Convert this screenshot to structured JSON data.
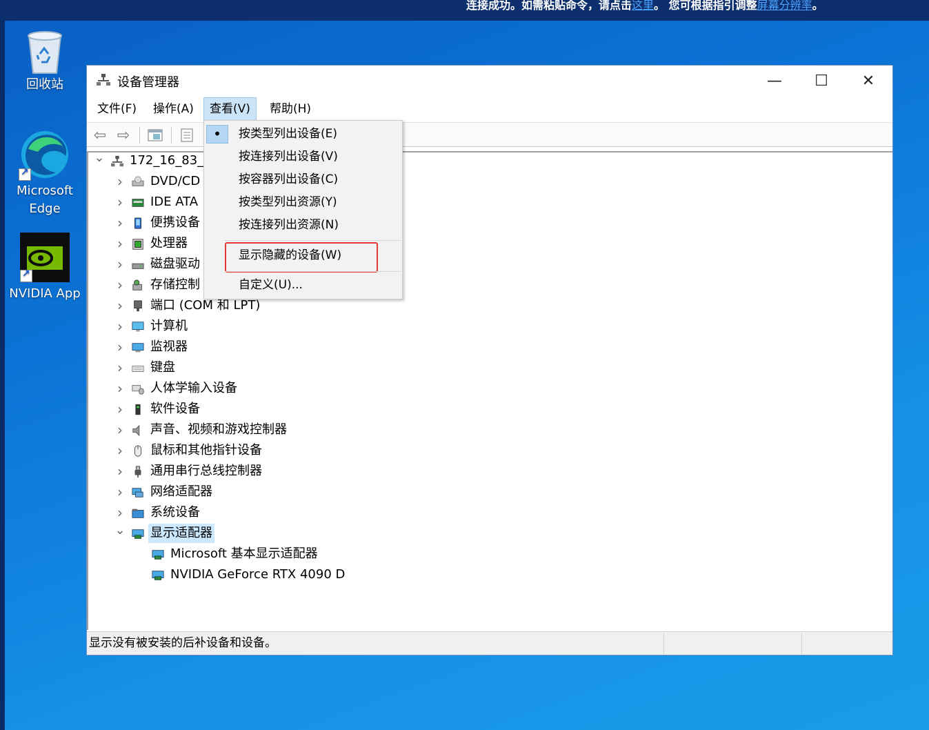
{
  "banner": {
    "part1": "连接成功。如需粘贴命令，请点击",
    "link1": "这里",
    "part2": "。 您可根据指引调整",
    "link2": "屏幕分辨率",
    "part3": "。"
  },
  "desktop": {
    "icons": [
      {
        "label": "回收站"
      },
      {
        "label": "Microsoft Edge"
      },
      {
        "label": "NVIDIA App"
      }
    ]
  },
  "window": {
    "title": "设备管理器",
    "controls": {
      "minimize": "—",
      "maximize": "☐",
      "close": "✕"
    }
  },
  "menubar": {
    "items": [
      {
        "label": "文件(F)"
      },
      {
        "label": "操作(A)"
      },
      {
        "label": "查看(V)"
      },
      {
        "label": "帮助(H)"
      }
    ]
  },
  "tree": {
    "root": "172_16_83_1",
    "root_visible": "172_16_83_",
    "nodes": [
      {
        "label": "DVD/CD",
        "icon": "dvd-drive-icon"
      },
      {
        "label": "IDE ATA",
        "icon": "ide-controller-icon"
      },
      {
        "label": "便携设备",
        "icon": "portable-device-icon"
      },
      {
        "label": "处理器",
        "icon": "processor-icon"
      },
      {
        "label": "磁盘驱动",
        "icon": "disk-drive-icon"
      },
      {
        "label": "存储控制",
        "icon": "storage-controller-icon"
      },
      {
        "label": "端口 (COM 和 LPT)",
        "icon": "port-icon"
      },
      {
        "label": "计算机",
        "icon": "computer-icon"
      },
      {
        "label": "监视器",
        "icon": "monitor-icon"
      },
      {
        "label": "键盘",
        "icon": "keyboard-icon"
      },
      {
        "label": "人体学输入设备",
        "icon": "hid-icon"
      },
      {
        "label": "软件设备",
        "icon": "software-device-icon"
      },
      {
        "label": "声音、视频和游戏控制器",
        "icon": "speaker-icon"
      },
      {
        "label": "鼠标和其他指针设备",
        "icon": "mouse-icon"
      },
      {
        "label": "通用串行总线控制器",
        "icon": "usb-icon"
      },
      {
        "label": "网络适配器",
        "icon": "network-adapter-icon"
      },
      {
        "label": "系统设备",
        "icon": "system-device-icon"
      },
      {
        "label": "显示适配器",
        "icon": "display-adapter-icon",
        "expanded": true,
        "selected": true
      }
    ],
    "display_children": [
      {
        "label": "Microsoft 基本显示适配器"
      },
      {
        "label": "NVIDIA GeForce RTX 4090 D"
      }
    ]
  },
  "view_menu": {
    "items": [
      {
        "label": "按类型列出设备(E)",
        "checked": true
      },
      {
        "label": "按连接列出设备(V)"
      },
      {
        "label": "按容器列出设备(C)"
      },
      {
        "label": "按类型列出资源(Y)"
      },
      {
        "label": "按连接列出资源(N)"
      },
      {
        "label": "显示隐藏的设备(W)",
        "highlighted": true
      },
      {
        "label": "自定义(U)..."
      }
    ],
    "check_glyph": "•"
  },
  "status": {
    "text": "显示没有被安装的后补设备和设备。"
  },
  "colors": {
    "highlight_border": "#e53935",
    "selection_bg": "#cce8ff",
    "menu_active_bg": "#cce4f7"
  }
}
